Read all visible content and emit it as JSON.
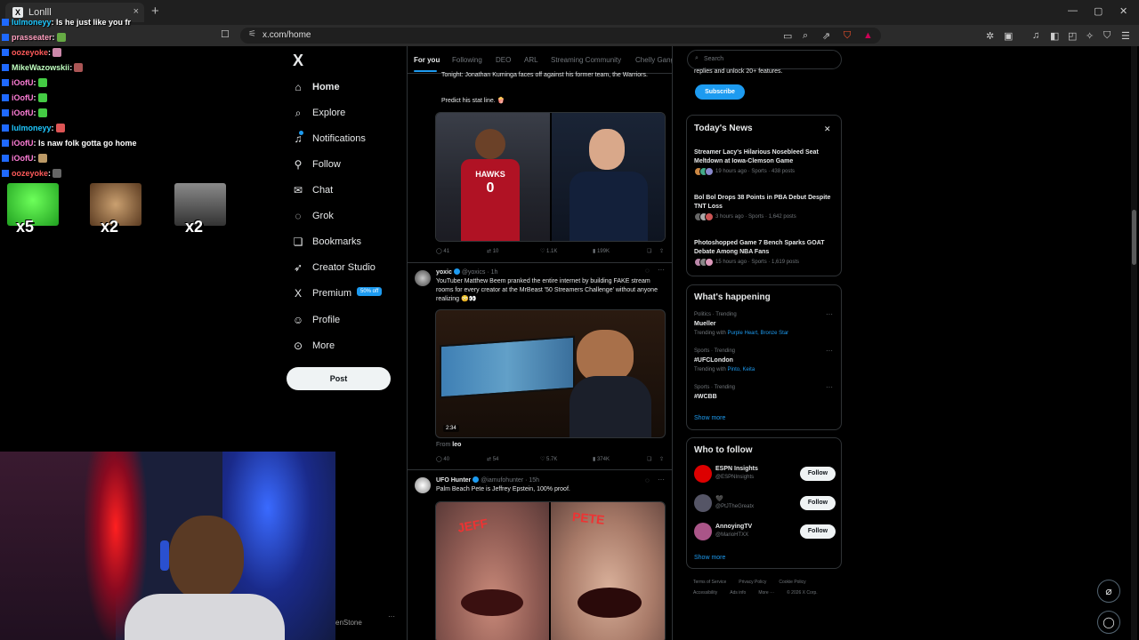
{
  "browser": {
    "tab_title": "Lonlll",
    "url": "x.com/home",
    "new_tab": "+",
    "tab_close": "×",
    "win_min": "—",
    "win_max": "▢",
    "win_close": "✕"
  },
  "nav": {
    "logo": "X",
    "items": [
      {
        "label": "Home",
        "icon": "home-icon",
        "glyph": "⌂"
      },
      {
        "label": "Explore",
        "icon": "search-icon",
        "glyph": "⌕"
      },
      {
        "label": "Notifications",
        "icon": "bell-icon",
        "glyph": "♫"
      },
      {
        "label": "Follow",
        "icon": "person-add-icon",
        "glyph": "⚲"
      },
      {
        "label": "Chat",
        "icon": "mail-icon",
        "glyph": "✉"
      },
      {
        "label": "Grok",
        "icon": "grok-icon",
        "glyph": "◌"
      },
      {
        "label": "Bookmarks",
        "icon": "bookmark-icon",
        "glyph": "❏"
      },
      {
        "label": "Creator Studio",
        "icon": "rocket-icon",
        "glyph": "➶"
      },
      {
        "label": "Premium",
        "icon": "x-premium-icon",
        "glyph": "X"
      },
      {
        "label": "Profile",
        "icon": "profile-icon",
        "glyph": "☺"
      },
      {
        "label": "More",
        "icon": "more-circle-icon",
        "glyph": "⊙"
      }
    ],
    "premium_badge": "50% off",
    "post_button": "Post"
  },
  "feed": {
    "tabs": [
      "For you",
      "Following",
      "DEO",
      "ARL",
      "Streaming Community",
      "Chelly Gang"
    ],
    "tweet1": {
      "text": "Tonight: Jonathan Kuminga faces off against his former team, the Warriors.",
      "text2": "Predict his stat line. 🍿",
      "jersey_team": "HAWKS",
      "jersey_number": "0",
      "replies": "41",
      "retweets": "10",
      "likes": "1.1K",
      "views": "199K"
    },
    "tweet2": {
      "name": "yoxic",
      "handle": "@yoxics · 1h",
      "text": "YouTuber Matthew Beem pranked the entire internet by building FAKE stream rooms for every creator at the MrBeast '50 Streamers Challenge' without anyone realizing 😳👀",
      "duration": "2:34",
      "from_label": "From",
      "from_user": "leo",
      "replies": "40",
      "retweets": "54",
      "likes": "5.7K",
      "views": "374K"
    },
    "tweet3": {
      "name": "UFO Hunter",
      "handle": "@iamufohunter · 15h",
      "text": "Palm Beach Pete is Jeffrey Epstein, 100% proof.",
      "img_left_label": "JEFF",
      "img_right_label": "PETE"
    }
  },
  "sidebar": {
    "search_placeholder": "Search",
    "premium_text": "replies and unlock 20+ features.",
    "subscribe": "Subscribe",
    "news_title": "Today's News",
    "news": [
      {
        "title": "Streamer Lacy's Hilarious Nosebleed Seat Meltdown at Iowa-Clemson Game",
        "meta": "19 hours ago · Sports · 438 posts"
      },
      {
        "title": "Bol Bol Drops 38 Points in PBA Debut Despite TNT Loss",
        "meta": "3 hours ago · Sports · 1,642 posts"
      },
      {
        "title": "Photoshopped Game 7 Bench Sparks GOAT Debate Among NBA Fans",
        "meta": "15 hours ago · Sports · 1,619 posts"
      }
    ],
    "happening_title": "What's happening",
    "trends": [
      {
        "meta": "Politics · Trending",
        "title": "Mueller",
        "sub_prefix": "Trending with",
        "sub_links": "Purple Heart, Bronze Star"
      },
      {
        "meta": "Sports · Trending",
        "title": "#UFCLondon",
        "sub_prefix": "Trending with",
        "sub_links": "Pinto, Keita"
      },
      {
        "meta": "Sports · Trending",
        "title": "#WCBB",
        "sub_prefix": "",
        "sub_links": ""
      }
    ],
    "show_more": "Show more",
    "wtf_title": "Who to follow",
    "wtf": [
      {
        "name": "ESPN Insights",
        "handle": "@ESPNInsights",
        "color": "#d00"
      },
      {
        "name": "🖤",
        "handle": "@PtJTheGreatx",
        "color": "#556"
      },
      {
        "name": "AnnoyingTV",
        "handle": "@MarioHTXX",
        "color": "#a58"
      }
    ],
    "follow": "Follow",
    "footer1": [
      "Terms of Service",
      "Privacy Policy",
      "Cookie Policy"
    ],
    "footer2": [
      "Accessibility",
      "Ads info",
      "More ···",
      "© 2026 X Corp."
    ]
  },
  "chat": {
    "lines": [
      {
        "user": "lulmoneyy",
        "msg": ": Is he just like you fr",
        "color": "#1ec8ff"
      },
      {
        "user": "prasseater",
        "msg": ":",
        "color": "#ffa0c0"
      },
      {
        "user": "oozeyoke",
        "msg": ":",
        "color": "#ff5a5a"
      },
      {
        "user": "MikeWazowskii",
        "msg": ":",
        "color": "#c0ffc0"
      },
      {
        "user": "iOofU",
        "msg": ":",
        "color": "#ff7dd7"
      },
      {
        "user": "iOofU",
        "msg": ":",
        "color": "#ff7dd7"
      },
      {
        "user": "iOofU",
        "msg": ":",
        "color": "#ff7dd7"
      },
      {
        "user": "lulmoneyy",
        "msg": ":",
        "color": "#1ec8ff"
      },
      {
        "user": "iOofU",
        "msg": ": Is naw folk gotta go home",
        "color": "#ff7dd7"
      },
      {
        "user": "iOofU",
        "msg": ":",
        "color": "#ff7dd7"
      },
      {
        "user": "oozeyoke",
        "msg": ":",
        "color": "#ff5a5a"
      }
    ],
    "combos": [
      "x5",
      "x2",
      "x2"
    ]
  },
  "webcam": {
    "label": "enStone"
  }
}
